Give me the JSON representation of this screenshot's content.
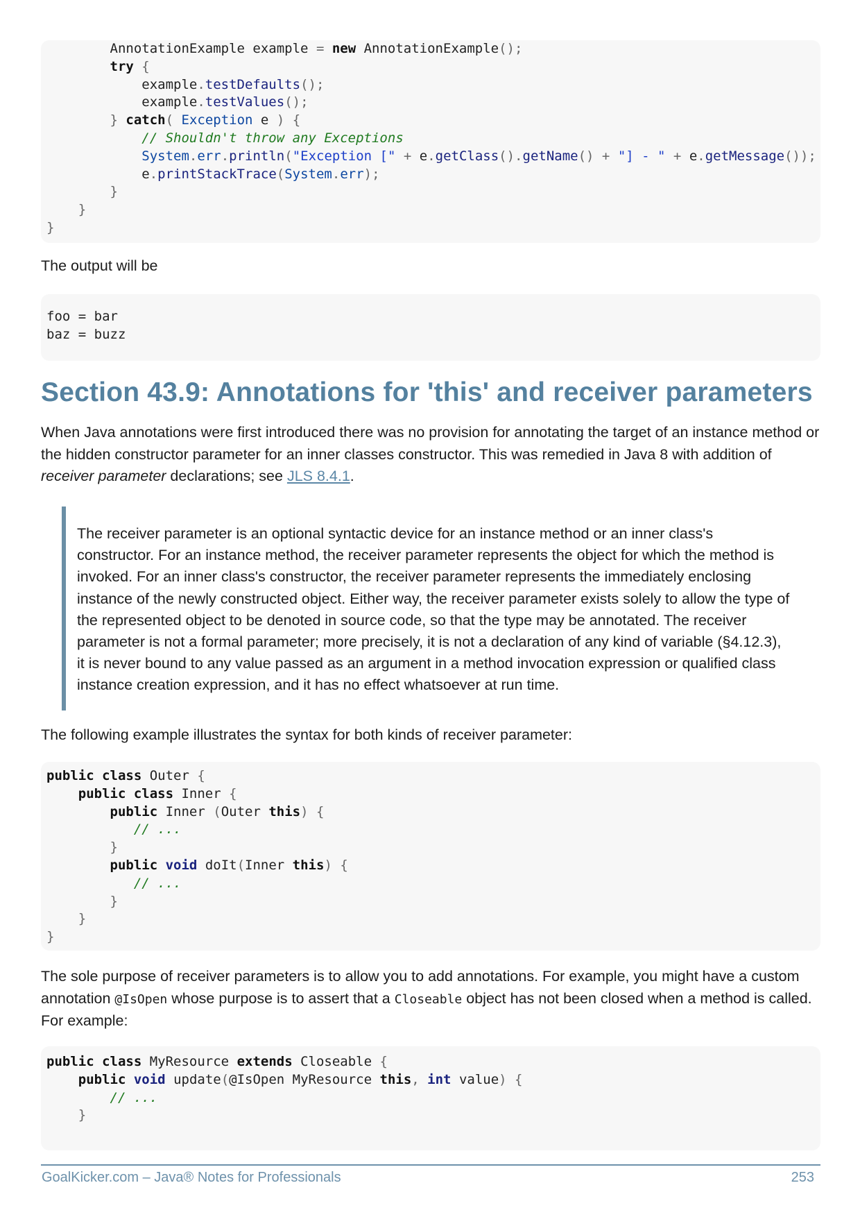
{
  "code1": [
    "        AnnotationExample example = new AnnotationExample();",
    "        try {",
    "            example.testDefaults();",
    "            example.testValues();",
    "        } catch( Exception e ) {",
    "            // Shouldn't throw any Exceptions",
    "            System.err.println(\"Exception [\" + e.getClass().getName() + \"] - \" + e.getMessage());",
    "            e.printStackTrace(System.err);",
    "        }",
    "    }",
    "}"
  ],
  "output_intro": "The output will be",
  "code2": [
    "foo = bar",
    "baz = buzz"
  ],
  "section_title": "Section 43.9: Annotations for 'this' and receiver parameters",
  "intro": {
    "text1": "When Java annotations were first introduced there was no provision for annotating the target of an instance method or the hidden constructor parameter for an inner classes constructor. This was remedied in Java 8 with addition of ",
    "emph": "receiver parameter",
    "text2": " declarations; see ",
    "link": "JLS 8.4.1",
    "text3": "."
  },
  "blockquote": "The receiver parameter is an optional syntactic device for an instance method or an inner class's constructor. For an instance method, the receiver parameter represents the object for which the method is invoked. For an inner class's constructor, the receiver parameter represents the immediately enclosing instance of the newly constructed object. Either way, the receiver parameter exists solely to allow the type of the represented object to be denoted in source code, so that the type may be annotated. The receiver parameter is not a formal parameter; more precisely, it is not a declaration of any kind of variable (§4.12.3), it is never bound to any value passed as an argument in a method invocation expression or qualified class instance creation expression, and it has no effect whatsoever at run time.",
  "example_intro": "The following example illustrates the syntax for both kinds of receiver parameter:",
  "code3": [
    "public class Outer {",
    "    public class Inner {",
    "        public Inner (Outer this) {",
    "           // ...",
    "        }",
    "        public void doIt(Inner this) {",
    "           // ...",
    "        }",
    "    }",
    "}"
  ],
  "purpose": {
    "text1": "The sole purpose of receiver parameters is to allow you to add annotations. For example, you might have a custom annotation ",
    "code1": "@IsOpen",
    "text2": " whose purpose is to assert that a ",
    "code2": "Closeable",
    "text3": " object has not been closed when a method is called. For example:"
  },
  "code4": [
    "public class MyResource extends Closeable {",
    "    public void update(@IsOpen MyResource this, int value) {",
    "        // ...",
    "    }"
  ],
  "footer": {
    "left": "GoalKicker.com – Java® Notes for Professionals",
    "page": "253"
  }
}
